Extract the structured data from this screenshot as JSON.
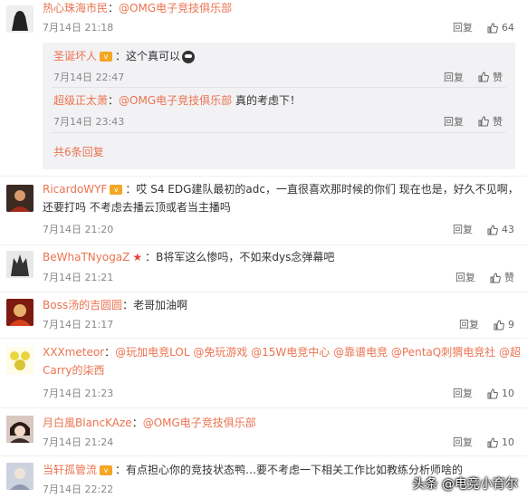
{
  "comments": [
    {
      "user": "热心珠海市民",
      "colon": "：",
      "mention": "@OMG电子竞技俱乐部",
      "text": "",
      "time": "7月14日 21:18",
      "reply": "回复",
      "likes": "64",
      "avatar_color": "#222222"
    },
    {
      "user": "RicardoWYF",
      "colon": "：",
      "text_line1": "哎 S4 EDG建队最初的adc，一直很喜欢那时候的你们 现在也是，好久不见啊，",
      "text_line2": "还要打吗 不考虑去播云顶或者当主播吗",
      "time": "7月14日 21:20",
      "reply": "回复",
      "likes": "43",
      "avatar_color": "#7a3b2a"
    },
    {
      "user": "BeWhaTNyogaZ",
      "colon": "：",
      "text": "B将军这么惨吗，不如来dys念弹幕吧",
      "time": "7月14日 21:21",
      "reply": "回复",
      "like_label": "赞",
      "avatar_color": "#3a3a3a"
    },
    {
      "user": "Boss汤的吉圆圆",
      "colon": "：",
      "text": "老哥加油啊",
      "time": "7月14日 21:17",
      "reply": "回复",
      "likes": "9",
      "avatar_color": "#c23b1f"
    },
    {
      "user": "XXXmeteor",
      "colon": "：",
      "mentions_line1": "@玩加电竞LOL @免玩游戏 @15W电竞中心 @靠谱电竞 @PentaQ刺猬电竞社 @超",
      "mentions_line2": "Carry的柒西",
      "time": "7月14日 21:23",
      "reply": "回复",
      "likes": "10",
      "avatar_color": "#e8d640"
    },
    {
      "user": "月白風BlancKAze",
      "colon": "：",
      "mention": "@OMG电子竞技俱乐部",
      "time": "7月14日 21:24",
      "reply": "回复",
      "likes": "10",
      "avatar_color": "#5a3d36"
    },
    {
      "user": "当轩孤管流",
      "colon": "：",
      "text": "有点担心你的竞技状态鸭…要不考虑一下相关工作比如教练分析师啥的",
      "time": "7月14日 22:22",
      "avatar_color": "#b8c0d0"
    }
  ],
  "sub_replies": [
    {
      "user": "圣诞坏人",
      "colon": "：",
      "text": "这个真可以",
      "time": "7月14日 22:47",
      "reply": "回复",
      "like_label": "赞"
    },
    {
      "user": "超级正太萧",
      "colon": "：",
      "mention": "@OMG电子竞技俱乐部",
      "text": " 真的考虑下！",
      "time": "7月14日 23:43",
      "reply": "回复",
      "like_label": "赞"
    }
  ],
  "sub_more": "共6条回复",
  "watermark": "头条 @电竞小育尔",
  "colors": {
    "accent": "#eb7350",
    "meta": "#888888",
    "subbox": "#f2f2f5"
  }
}
